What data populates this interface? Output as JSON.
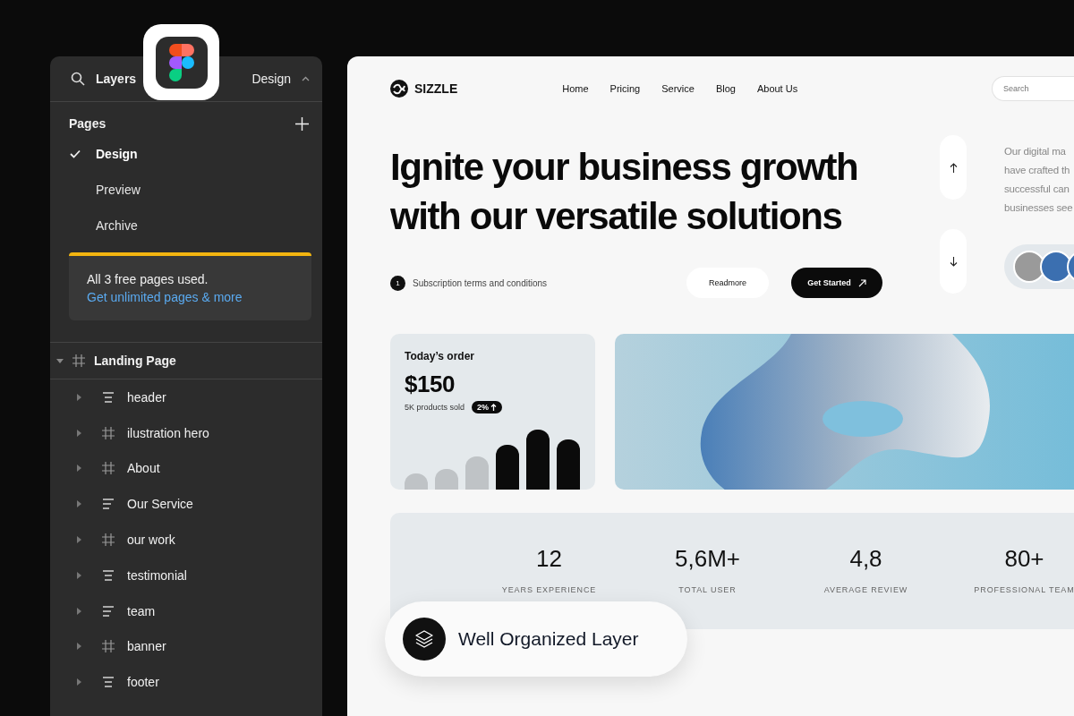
{
  "layers_panel": {
    "title": "Layers",
    "page_switch": "Design",
    "pages_heading": "Pages",
    "pages": [
      {
        "label": "Design",
        "selected": true
      },
      {
        "label": "Preview",
        "selected": false
      },
      {
        "label": "Archive",
        "selected": false
      }
    ],
    "notice": {
      "text": "All 3 free pages used.",
      "link": "Get unlimited pages & more"
    },
    "layers": [
      {
        "label": "Landing Page",
        "kind": "frame",
        "expanded": true,
        "children": [
          {
            "label": "header",
            "kind": "stack-center",
            "expanded": false
          },
          {
            "label": "ilustration hero",
            "kind": "frame",
            "expanded": false
          },
          {
            "label": "About",
            "kind": "frame",
            "expanded": false
          },
          {
            "label": "Our Service",
            "kind": "stack-left",
            "expanded": false
          },
          {
            "label": "our work",
            "kind": "frame",
            "expanded": false
          },
          {
            "label": "testimonial",
            "kind": "stack-center",
            "expanded": false
          },
          {
            "label": "team",
            "kind": "stack-left",
            "expanded": false
          },
          {
            "label": "banner",
            "kind": "frame",
            "expanded": false
          },
          {
            "label": "footer",
            "kind": "stack-center",
            "expanded": false
          }
        ]
      }
    ]
  },
  "website": {
    "brand": "SIZZLE",
    "nav": [
      "Home",
      "Pricing",
      "Service",
      "Blog",
      "About Us"
    ],
    "search": {
      "placeholder": "Search"
    },
    "headline": "Ignite your business growth with our versatile solutions",
    "step_number": "1",
    "step_text": "Subscription terms and conditions",
    "buttons": [
      {
        "label": "Readmore",
        "kind": "secondary"
      },
      {
        "label": "Get Started",
        "kind": "primary"
      }
    ],
    "description": [
      "Our digital ma",
      "have crafted th",
      "successful can",
      "businesses see"
    ],
    "order_card": {
      "title": "Today’s order",
      "amount": "$150",
      "subtitle": "5K products sold",
      "badge": "2%"
    },
    "stats": [
      {
        "value": "12",
        "label": "YEARS EXPERIENCE"
      },
      {
        "value": "5,6M+",
        "label": "TOTAL USER"
      },
      {
        "value": "4,8",
        "label": "AVERAGE REVIEW"
      },
      {
        "value": "80+",
        "label": "PROFESSIONAL TEAM"
      }
    ]
  },
  "callout": {
    "label": "Well Organized Layer"
  }
}
